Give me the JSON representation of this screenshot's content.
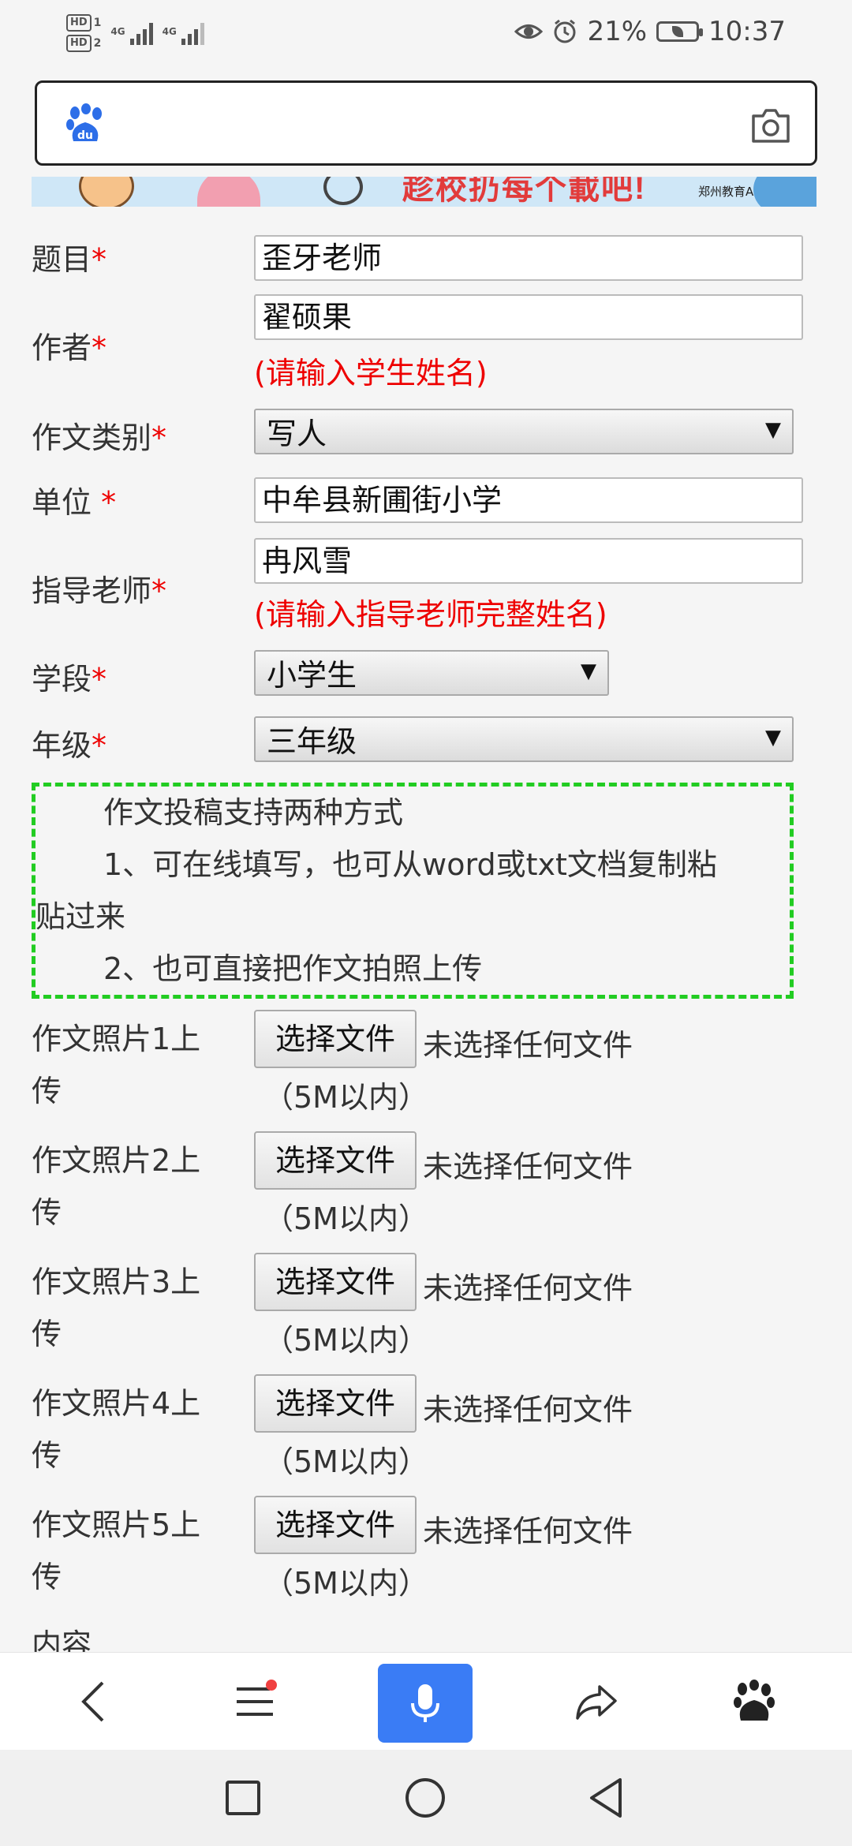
{
  "status_bar": {
    "hd1": "HD",
    "hd1_num": "1",
    "hd2": "HD",
    "hd2_num": "2",
    "network1": "4G",
    "network2": "4G",
    "battery": "21%",
    "time": "10:37"
  },
  "search": {
    "placeholder": "",
    "logo_text": "du"
  },
  "banner": {
    "text": "趁校扔每个載吧!",
    "app_name": "郑州教育APP"
  },
  "form": {
    "title_label": "题目",
    "title_value": "歪牙老师",
    "author_label": "作者",
    "author_value": "翟硕果",
    "author_hint": "(请输入学生姓名)",
    "category_label": "作文类别",
    "category_value": "写人",
    "unit_label": "单位 ",
    "unit_value": "中牟县新圃街小学",
    "teacher_label": "指导老师",
    "teacher_value": "冉风雪",
    "teacher_hint": "(请输入指导老师完整姓名)",
    "stage_label": "学段",
    "stage_value": "小学生",
    "grade_label": "年级",
    "grade_value": "三年级",
    "required_mark": "*",
    "select_arrow": "▼"
  },
  "notice": {
    "line1": "作文投稿支持两种方式",
    "line2a": "1、可在线填写，也可从word或txt文档复制粘",
    "line2b": "贴过来",
    "line3": "2、也可直接把作文拍照上传"
  },
  "uploads": [
    {
      "label_a": "作文照片1上",
      "label_b": "传",
      "button": "选择文件",
      "status": "未选择任何文件",
      "limit": "（5M以内）"
    },
    {
      "label_a": "作文照片2上",
      "label_b": "传",
      "button": "选择文件",
      "status": "未选择任何文件",
      "limit": "（5M以内）"
    },
    {
      "label_a": "作文照片3上",
      "label_b": "传",
      "button": "选择文件",
      "status": "未选择任何文件",
      "limit": "（5M以内）"
    },
    {
      "label_a": "作文照片4上",
      "label_b": "传",
      "button": "选择文件",
      "status": "未选择任何文件",
      "limit": "（5M以内）"
    },
    {
      "label_a": "作文照片5上",
      "label_b": "传",
      "button": "选择文件",
      "status": "未选择任何文件",
      "limit": "（5M以内）"
    }
  ],
  "content_label": "内容",
  "toolbar": {
    "items": [
      "back-icon",
      "menu-icon",
      "mic-icon",
      "share-icon",
      "baidu-paw-icon"
    ]
  },
  "nav": {
    "items": [
      "recent-apps-icon",
      "home-icon",
      "back-nav-icon"
    ]
  },
  "colors": {
    "required": "#ee0000",
    "notice_border": "#22cc22",
    "mic_button": "#3a7cf5"
  }
}
